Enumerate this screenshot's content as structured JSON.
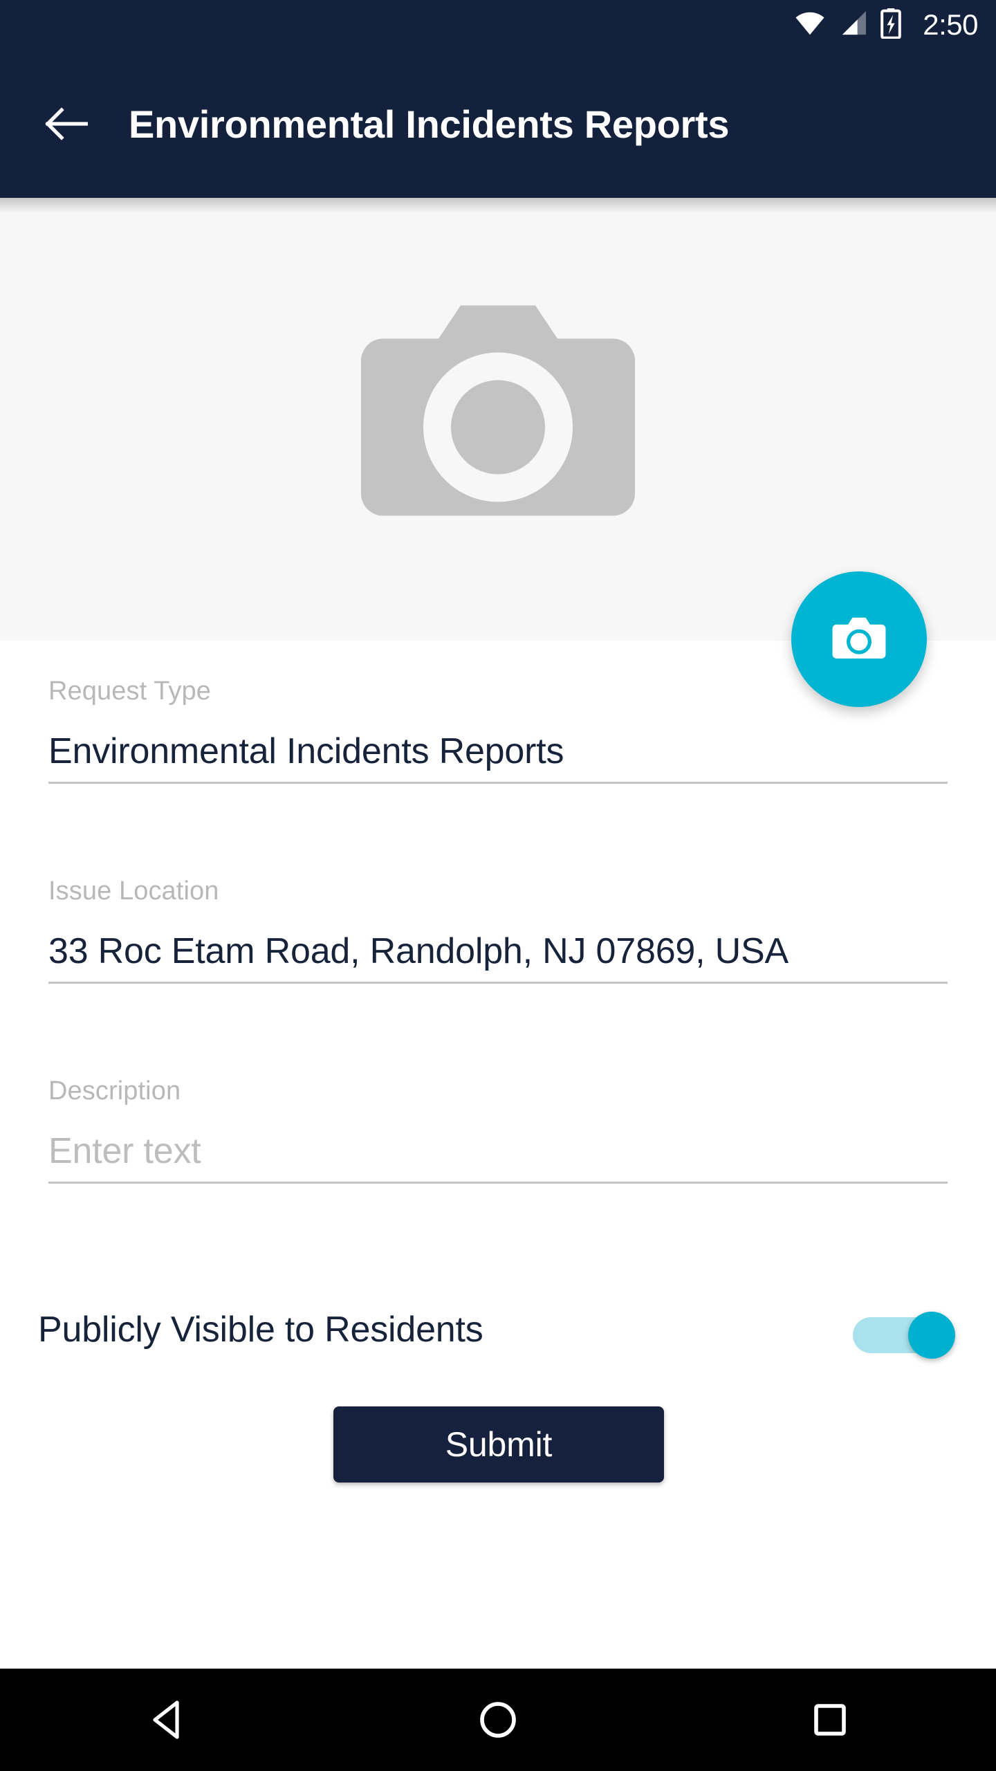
{
  "status_bar": {
    "time": "2:50",
    "icons": [
      "wifi-icon",
      "cellular-signal-icon",
      "battery-charging-icon"
    ]
  },
  "app_bar": {
    "back_icon": "back-arrow-icon",
    "title": "Environmental Incidents Reports",
    "background": "#14213d"
  },
  "photo_area": {
    "placeholder_icon": "camera-placeholder-icon",
    "background": "#f7f7f8",
    "icon_color": "#c3c3c3"
  },
  "fab": {
    "icon": "camera-icon",
    "color": "#00b5d2",
    "label": ""
  },
  "form": {
    "fields": [
      {
        "label": "Request Type",
        "value": "Environmental Incidents Reports",
        "placeholder": ""
      },
      {
        "label": "Issue Location",
        "value": "33 Roc Etam Road, Randolph, NJ 07869, USA",
        "placeholder": ""
      },
      {
        "label": "Description",
        "value": "",
        "placeholder": "Enter text"
      }
    ],
    "toggle": {
      "label": "Publicly Visible to Residents",
      "state": "on",
      "on_color": "#00b0cf",
      "track_color": "#a9e2ec"
    },
    "submit_label": "Submit",
    "submit_color": "#16213e"
  },
  "nav_bar": {
    "background": "#000000",
    "buttons": [
      {
        "name": "back-nav-icon"
      },
      {
        "name": "home-nav-icon"
      },
      {
        "name": "recents-nav-icon"
      }
    ]
  }
}
